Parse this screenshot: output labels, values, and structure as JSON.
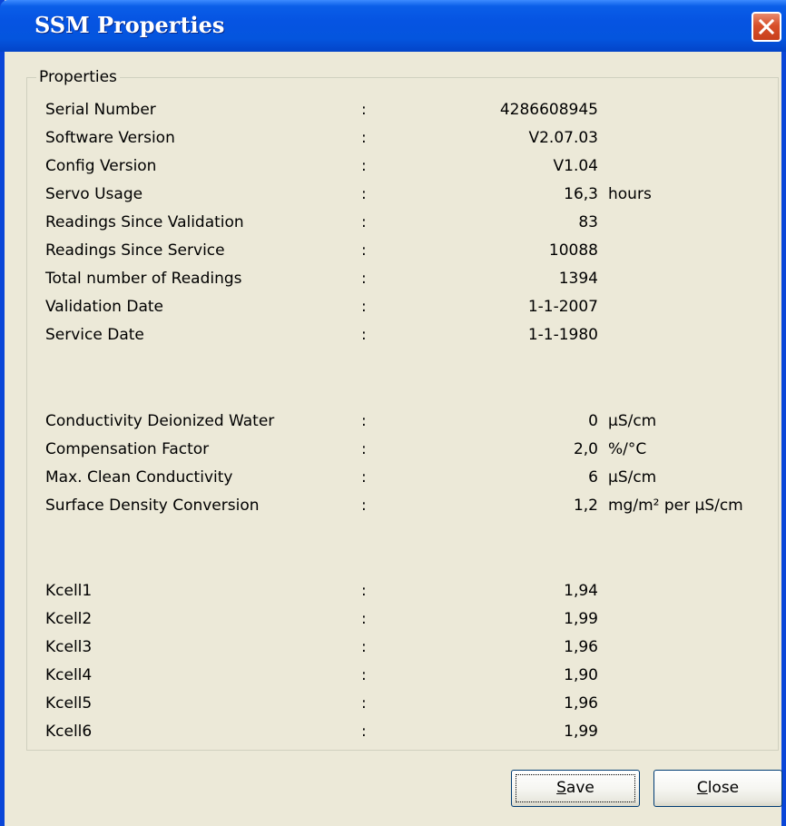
{
  "window": {
    "title": "SSM Properties",
    "close_icon": "close-x-icon"
  },
  "properties": {
    "legend": "Properties",
    "separator": ":",
    "rows": [
      {
        "label": "Serial Number",
        "value": "4286608945",
        "unit": ""
      },
      {
        "label": "Software Version",
        "value": "V2.07.03",
        "unit": ""
      },
      {
        "label": "Config Version",
        "value": "V1.04",
        "unit": ""
      },
      {
        "label": "Servo Usage",
        "value": "16,3",
        "unit": "hours"
      },
      {
        "label": "Readings Since Validation",
        "value": "83",
        "unit": ""
      },
      {
        "label": "Readings Since Service",
        "value": "10088",
        "unit": ""
      },
      {
        "label": "Total number of Readings",
        "value": "1394",
        "unit": ""
      },
      {
        "label": "Validation Date",
        "value": "1-1-2007",
        "unit": ""
      },
      {
        "label": "Service Date",
        "value": "1-1-1980",
        "unit": ""
      },
      {
        "label": "Conductivity Deionized Water",
        "value": "0",
        "unit": "µS/cm"
      },
      {
        "label": "Compensation Factor",
        "value": "2,0",
        "unit": "%/°C"
      },
      {
        "label": "Max. Clean Conductivity",
        "value": "6",
        "unit": "µS/cm"
      },
      {
        "label": "Surface Density Conversion",
        "value": "1,2",
        "unit": "mg/m² per µS/cm"
      },
      {
        "label": "Kcell1",
        "value": "1,94",
        "unit": ""
      },
      {
        "label": "Kcell2",
        "value": "1,99",
        "unit": ""
      },
      {
        "label": "Kcell3",
        "value": "1,96",
        "unit": ""
      },
      {
        "label": "Kcell4",
        "value": "1,90",
        "unit": ""
      },
      {
        "label": "Kcell5",
        "value": "1,96",
        "unit": ""
      },
      {
        "label": "Kcell6",
        "value": "1,99",
        "unit": ""
      }
    ]
  },
  "buttons": {
    "save_label": "Save",
    "save_mnemonic": "S",
    "save_rest": "ave",
    "close_label": "Close",
    "close_mnemonic": "C",
    "close_rest": "lose"
  },
  "colors": {
    "titlebar": "#0455de",
    "window_face": "#ece9d8",
    "close_button": "#d8502a",
    "button_border": "#003c74"
  }
}
